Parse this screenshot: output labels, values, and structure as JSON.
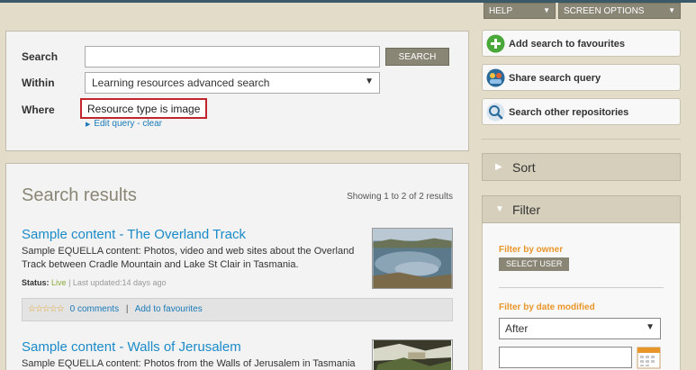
{
  "topbar": {
    "help_label": "HELP",
    "screen_options_label": "SCREEN OPTIONS"
  },
  "search": {
    "search_label": "Search",
    "search_value": "",
    "search_button": "SEARCH",
    "within_label": "Within",
    "within_value": "Learning resources advanced search",
    "where_label": "Where",
    "where_value": "Resource type is image",
    "edit_query": "Edit query",
    "dash": "-",
    "clear": "clear"
  },
  "results": {
    "title": "Search results",
    "count": "Showing 1 to 2 of 2 results",
    "items": [
      {
        "title": "Sample content - The Overland Track",
        "desc": "Sample EQUELLA content: Photos, video and web sites about the Overland Track between Cradle Mountain and Lake St Clair in Tasmania.",
        "status_label": "Status:",
        "status_value": "Live",
        "updated": "| Last updated:14 days ago",
        "stars": "☆☆☆☆☆",
        "comments": "0 comments",
        "favourites": "Add to favourites"
      },
      {
        "title": "Sample content - Walls of Jerusalem",
        "desc": "Sample EQUELLA content: Photos from the Walls of Jerusalem in Tasmania"
      }
    ]
  },
  "sidebar": {
    "add_fav": "Add search to favourites",
    "share": "Share search query",
    "other_repos": "Search other repositories",
    "sort": "Sort",
    "filter": "Filter",
    "filter_owner": "Filter by owner",
    "select_user": "SELECT USER",
    "filter_date": "Filter by date modified",
    "date_option": "After",
    "date_value": ""
  },
  "colors": {
    "accent_link": "#1a8ac8",
    "button_bg": "#8a8676",
    "filter_label": "#e8962a",
    "where_border": "#c0262c"
  }
}
